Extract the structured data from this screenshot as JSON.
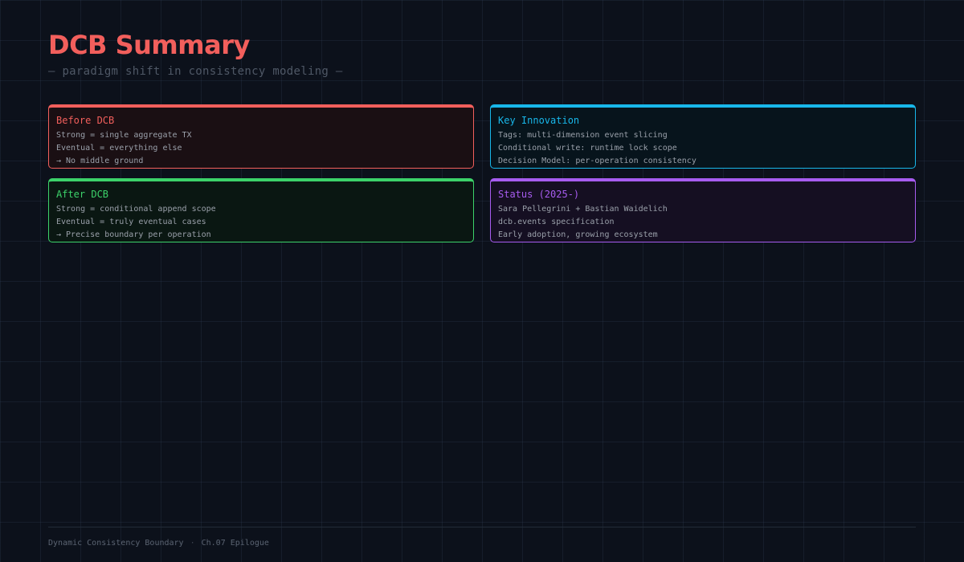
{
  "header": {
    "title": "DCB Summary",
    "subtitle": "— paradigm shift in consistency modeling —"
  },
  "cards": [
    {
      "title": "Before DCB",
      "accent": "#f25f5c",
      "lines": [
        "Strong = single aggregate TX",
        "Eventual = everything else",
        "→ No middle ground"
      ]
    },
    {
      "title": "Key Innovation",
      "accent": "#18b7ea",
      "lines": [
        "Tags: multi-dimension event slicing",
        "Conditional write: runtime lock scope",
        "Decision Model: per-operation consistency"
      ]
    },
    {
      "title": "After DCB",
      "accent": "#3cd26a",
      "lines": [
        "Strong = conditional append scope",
        "Eventual = truly eventual cases",
        "→ Precise boundary per operation"
      ]
    },
    {
      "title": "Status (2025-)",
      "accent": "#a75cf0",
      "lines": [
        "Sara Pellegrini + Bastian Waidelich",
        "dcb.events specification",
        "Early adoption, growing ecosystem"
      ]
    }
  ],
  "footer": {
    "left": "Dynamic Consistency Boundary",
    "separator": "·",
    "right": "Ch.07 Epilogue"
  },
  "colors": {
    "background": "#0c111b",
    "title": "#f25f5c",
    "text": "#9aa0aa",
    "muted": "#4f5866"
  }
}
